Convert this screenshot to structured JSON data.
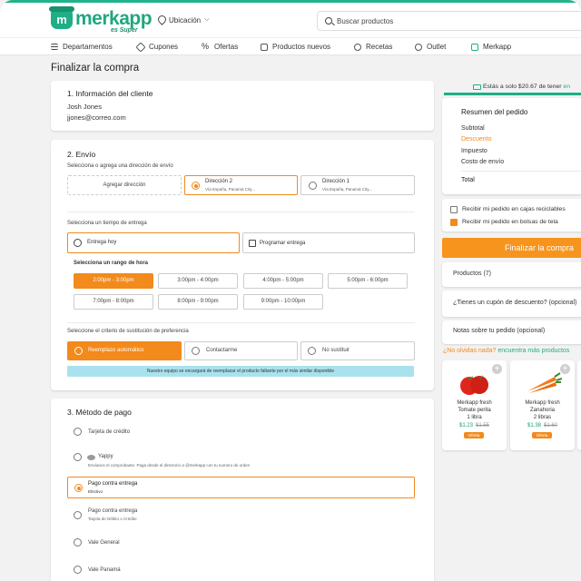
{
  "brand": {
    "name": "merkapp",
    "tagline": "es Super",
    "bag_letter": "m",
    "accent": "#1fae86",
    "orange": "#f28a1c"
  },
  "header": {
    "location": "Ubicación",
    "search_placeholder": "Buscar productos"
  },
  "nav": [
    "Departamentos",
    "Cupones",
    "Ofertas",
    "Productos nuevos",
    "Recetas",
    "Outlet",
    "Merkapp"
  ],
  "page_title": "Finalizar la compra",
  "client": {
    "title": "1. Información del cliente",
    "name": "Josh Jones",
    "email": "jjones@correo.com"
  },
  "shipping": {
    "title": "2. Envío",
    "address_prompt": "Selecciona o agrega una dirección de envío",
    "add_address": "Agregar dirección",
    "addresses": [
      {
        "name": "Dirección 2",
        "detail": "Vía España, Panamá City...",
        "selected": true
      },
      {
        "name": "Dirección 1",
        "detail": "Vía España, Panamá City...",
        "selected": false
      }
    ],
    "time_prompt": "Selecciona un tiempo de entrega",
    "delivery_today": "Entrega hoy",
    "schedule": "Programar entrega",
    "range_prompt": "Selecciona un rango de hora",
    "slots": [
      "2:00pm - 3:00pm",
      "3:00pm - 4:00pm",
      "4:00pm - 5:00pm",
      "5:00pm - 6:00pm",
      "7:00pm - 8:00pm",
      "8:00pm - 9:00pm",
      "9:00pm - 10:00pm"
    ],
    "substitution_prompt": "Seleccione el criterio de sustitución de preferencia",
    "substitution_options": [
      "Reemplazo automático",
      "Contactarme",
      "No sustituir"
    ],
    "info": "Nuestro equipo se encargará de reemplazar el producto faltante por el más similar disponible"
  },
  "payment": {
    "title": "3. Método de pago",
    "credit": "Tarjeta de crédito",
    "yappy": "Yappy",
    "yappy_note": "Envíanos el comprobante. Paga desde el directorio a @merkapp con tu numero de orden",
    "cod_cash": "Pago contra entrega",
    "cod_cash_sub": "Efectivo",
    "cod_card": "Pago contra entrega",
    "cod_card_sub": "Tarjeta de Débito o Crédito",
    "vale_general": "Vale General",
    "vale_panama": "Vale Panamá"
  },
  "summary": {
    "promo": "Estás a solo $20.67 de tener",
    "promo_link": "en",
    "title": "Resumen del pedido",
    "rows": [
      "Subtotal",
      "Descuento",
      "Impuesto",
      "Costo de envío"
    ],
    "total": "Total",
    "bag_options": [
      {
        "label": "Recibir mi pedido en cajas reciclables",
        "checked": false
      },
      {
        "label": "Recibir mi pedido en bolsas de tela",
        "checked": true
      }
    ],
    "finalize": "Finalizar la compra",
    "products": "Productos (7)",
    "coupon": "¿Tienes un cupón de descuento? (opcional)",
    "notes": "Notas sobre tu pedido (opcional)",
    "reminder": "¿No olvidas nada?",
    "reminder_link": "encuentra más productos"
  },
  "suggestions": [
    {
      "line1": "Merkapp fresh",
      "line2": "Tomate perita",
      "line3": "1 libra",
      "price": "$1.23",
      "old_price": "$1.55",
      "badge": "Oferta"
    },
    {
      "line1": "Merkapp fresh",
      "line2": "Zanahoria",
      "line3": "2 libras",
      "price": "$1.38",
      "old_price": "$1.60",
      "badge": "Oferta"
    }
  ]
}
